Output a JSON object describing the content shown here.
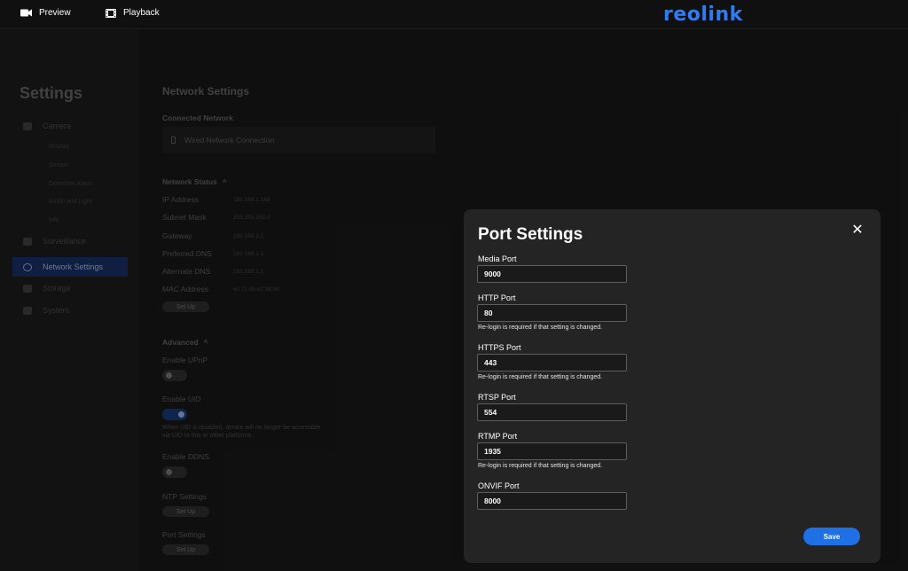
{
  "topbar": {
    "preview_label": "Preview",
    "playback_label": "Playback",
    "logo_text": "reolink"
  },
  "sidebar": {
    "title": "Settings",
    "items": [
      {
        "label": "Camera",
        "icon": "camera-icon"
      },
      {
        "label": "Surveillance",
        "icon": "monitor-icon"
      },
      {
        "label": "Network Settings",
        "icon": "globe-icon",
        "active": true
      },
      {
        "label": "Storage",
        "icon": "storage-icon"
      },
      {
        "label": "System",
        "icon": "gear-icon"
      }
    ],
    "camera_subitems": [
      "Display",
      "Stream",
      "Detection Alarm",
      "Audio and Light",
      "Info"
    ]
  },
  "main": {
    "title": "Network Settings",
    "connected_network_heading": "Connected Network",
    "connected_network_value": "Wired Network Connection",
    "network_status_heading": "Network Status",
    "status": [
      {
        "label": "IP Address",
        "value": "192.168.1.168"
      },
      {
        "label": "Subnet Mask",
        "value": "255.255.255.0"
      },
      {
        "label": "Gateway",
        "value": "192.168.1.1"
      },
      {
        "label": "Preferred DNS",
        "value": "192.168.1.1"
      },
      {
        "label": "Alternate DNS",
        "value": "192.168.1.1"
      },
      {
        "label": "MAC Address",
        "value": "ec:71:db:e2:38:66"
      }
    ],
    "setup_label": "Set Up",
    "advanced_heading": "Advanced",
    "enable_upnp_label": "Enable UPnP",
    "enable_upnp_on": false,
    "enable_uid_label": "Enable UID",
    "enable_uid_on": true,
    "uid_note": "When UID is disabled, device will no longer be accessible via UID to this or other platforms.",
    "enable_ddns_label": "Enable DDNS",
    "enable_ddns_on": false,
    "ntp_label": "NTP Settings",
    "port_settings_label": "Port Settings"
  },
  "modal": {
    "title": "Port Settings",
    "fields": [
      {
        "label": "Media Port",
        "value": "9000",
        "hint": ""
      },
      {
        "label": "HTTP Port",
        "value": "80",
        "hint": "Re-login is required if that setting is changed."
      },
      {
        "label": "HTTPS Port",
        "value": "443",
        "hint": "Re-login is required if that setting is changed."
      },
      {
        "label": "RTSP Port",
        "value": "554",
        "hint": ""
      },
      {
        "label": "RTMP Port",
        "value": "1935",
        "hint": "Re-login is required if that setting is changed."
      },
      {
        "label": "ONVIF Port",
        "value": "8000",
        "hint": ""
      }
    ],
    "save_label": "Save"
  },
  "colors": {
    "accent": "#1f6fe5",
    "logo": "#2e7bf6",
    "active_nav": "#142b5a"
  }
}
